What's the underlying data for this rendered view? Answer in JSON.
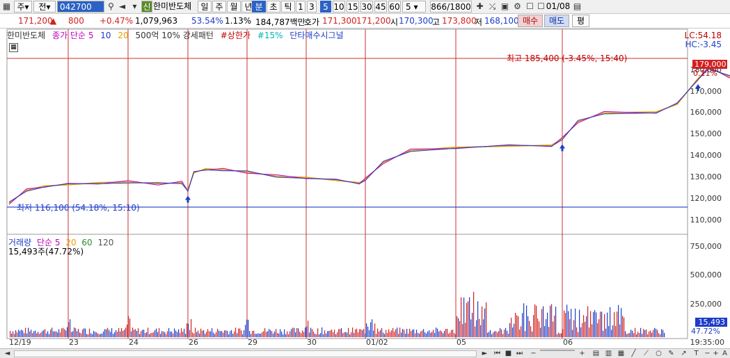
{
  "toolbar": {
    "type_label": "주",
    "prev_label": "전",
    "code": "042700",
    "stock_name": "한미반도체",
    "badge": "신",
    "periods": [
      "일",
      "주",
      "월",
      "년"
    ],
    "minute_label": "분",
    "second_label": "초",
    "tick_label": "틱",
    "intervals": [
      "1",
      "3",
      "5",
      "10",
      "15",
      "30",
      "45",
      "60"
    ],
    "selected_interval": "5",
    "interval_select": "5",
    "count": "866/1800",
    "date": "01/08"
  },
  "quote": {
    "price": "171,200",
    "change": "800",
    "change_pct": "+0.47%",
    "volume": "1,079,963",
    "ratio": "53.54%",
    "turnover": "1.13%",
    "amount": "184,787백만",
    "bid_label": "호가",
    "bid1": "171,300",
    "bid2": "171,200",
    "open_label": "시",
    "open": "170,300",
    "high_label": "고",
    "high": "173,800",
    "low_label": "저",
    "low": "168,100",
    "buy_label": "매수",
    "sell_label": "매도",
    "eval_label": "평"
  },
  "legend": {
    "name": "한미반도체",
    "price_ma": "종가 단순 5",
    "ma10": "10",
    "ma20": "20",
    "filter": "500억 10% 강세패턴",
    "upper": "#상한가",
    "pct15": "#15%",
    "signal": "단타매수시그널"
  },
  "right_top": {
    "lc": "LC:54.18",
    "hc": "HC:-3.45"
  },
  "price_tag": {
    "price": "179,000",
    "pct": "0.11%"
  },
  "annotations": {
    "high": "최고 185,400 (-3.45%, 15:40)",
    "low": "최저 116,100 (54.18%, 15:10)"
  },
  "volume_legend": {
    "title": "거래량",
    "ma": "단순 5",
    "ma20": "20",
    "ma60": "60",
    "ma120": "120",
    "count": "15,493주(47.72%)"
  },
  "volume_tag": {
    "value": "15,493",
    "pct": "47.72%"
  },
  "time_label": "19:35:00",
  "colors": {
    "up": "#d22020",
    "down": "#1e3cc8",
    "ma5": "#c000c0",
    "ma10": "#1e3cc8",
    "ma20": "#e6a000",
    "ma60": "#2a8a2a"
  },
  "chart_data": {
    "type": "line",
    "y_ticks": [
      "110,000",
      "120,000",
      "130,000",
      "140,000",
      "150,000",
      "160,000",
      "170,000",
      "180,000"
    ],
    "vol_ticks": [
      "750,000",
      "500,000",
      "250,000"
    ],
    "x_labels": [
      "12/19",
      "23",
      "24",
      "26",
      "29",
      "30",
      "01/02",
      "05",
      "06"
    ],
    "ylim": [
      107000,
      188000
    ],
    "price_series": [
      {
        "t": 0,
        "v": 118000
      },
      {
        "t": 0.3,
        "v": 124000
      },
      {
        "t": 0.6,
        "v": 126000
      },
      {
        "t": 1.0,
        "v": 126500
      },
      {
        "t": 1.5,
        "v": 127500
      },
      {
        "t": 2.0,
        "v": 127800
      },
      {
        "t": 2.5,
        "v": 127000
      },
      {
        "t": 2.9,
        "v": 127500
      },
      {
        "t": 3.0,
        "v": 124000
      },
      {
        "t": 3.1,
        "v": 132000
      },
      {
        "t": 3.3,
        "v": 134000
      },
      {
        "t": 3.6,
        "v": 133500
      },
      {
        "t": 4.0,
        "v": 132500
      },
      {
        "t": 4.5,
        "v": 130500
      },
      {
        "t": 5.0,
        "v": 130000
      },
      {
        "t": 5.5,
        "v": 128500
      },
      {
        "t": 5.9,
        "v": 127500
      },
      {
        "t": 6.0,
        "v": 129000
      },
      {
        "t": 6.2,
        "v": 137000
      },
      {
        "t": 6.5,
        "v": 142500
      },
      {
        "t": 7.0,
        "v": 144000
      },
      {
        "t": 7.5,
        "v": 144500
      },
      {
        "t": 7.9,
        "v": 145000
      },
      {
        "t": 8.0,
        "v": 148000
      },
      {
        "t": 8.15,
        "v": 156000
      },
      {
        "t": 8.4,
        "v": 160000
      },
      {
        "t": 8.9,
        "v": 160500
      },
      {
        "t": 9.1,
        "v": 164000
      },
      {
        "t": 9.3,
        "v": 176000
      },
      {
        "t": 9.4,
        "v": 181000
      },
      {
        "t": 9.6,
        "v": 177000
      },
      {
        "t": 9.9,
        "v": 176500
      },
      {
        "t": 10.1,
        "v": 169000
      },
      {
        "t": 10.3,
        "v": 177000
      },
      {
        "t": 10.5,
        "v": 181000
      },
      {
        "t": 10.8,
        "v": 181500
      },
      {
        "t": 11.0,
        "v": 178500
      },
      {
        "t": 11.3,
        "v": 183000
      },
      {
        "t": 11.6,
        "v": 180500
      },
      {
        "t": 11.9,
        "v": 179000
      }
    ],
    "signals_t": [
      3.0,
      8.0,
      9.3,
      10.1
    ],
    "high": 185400,
    "low": 116100
  }
}
